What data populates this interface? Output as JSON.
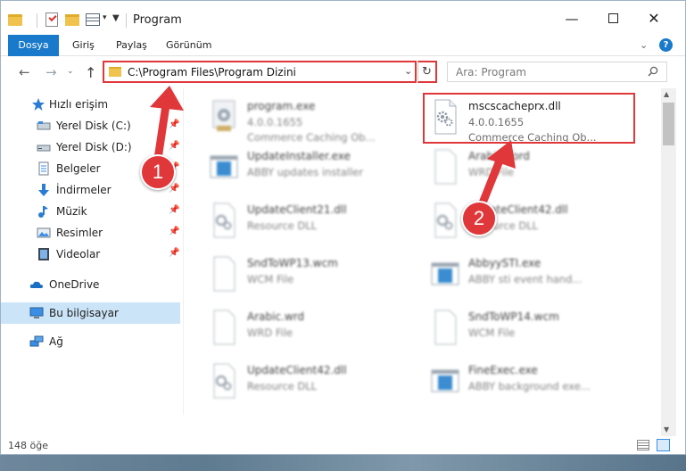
{
  "titlebar": {
    "title": "Program",
    "quick_access_icons": [
      "folder-icon",
      "properties-check-icon",
      "new-folder-icon",
      "properties-icon"
    ],
    "controls": {
      "minimize": "—",
      "maximize": "☐",
      "close": "✕"
    }
  },
  "ribbon": {
    "tabs": [
      {
        "label": "Dosya",
        "active": true
      },
      {
        "label": "Giriş",
        "active": false
      },
      {
        "label": "Paylaş",
        "active": false
      },
      {
        "label": "Görünüm",
        "active": false
      }
    ],
    "help": "?"
  },
  "navbar": {
    "address": "C:\\Program Files\\Program Dizini",
    "search_placeholder": "Ara: Program"
  },
  "sidebar": {
    "items": [
      {
        "label": "Hızlı erişim",
        "icon": "star-icon",
        "pinned": false,
        "selected": false
      },
      {
        "label": "Yerel Disk (C:)",
        "icon": "drive-icon",
        "pinned": true,
        "selected": false
      },
      {
        "label": "Yerel Disk (D:)",
        "icon": "drive-icon",
        "pinned": true,
        "selected": false
      },
      {
        "label": "Belgeler",
        "icon": "documents-icon",
        "pinned": true,
        "selected": false
      },
      {
        "label": "İndirmeler",
        "icon": "download-icon",
        "pinned": true,
        "selected": false
      },
      {
        "label": "Müzik",
        "icon": "music-icon",
        "pinned": true,
        "selected": false
      },
      {
        "label": "Resimler",
        "icon": "pictures-icon",
        "pinned": true,
        "selected": false
      },
      {
        "label": "Videolar",
        "icon": "videos-icon",
        "pinned": true,
        "selected": false
      },
      {
        "label": "OneDrive",
        "icon": "cloud-icon",
        "pinned": false,
        "selected": false
      },
      {
        "label": "Bu bilgisayar",
        "icon": "computer-icon",
        "pinned": false,
        "selected": true
      },
      {
        "label": "Ağ",
        "icon": "network-icon",
        "pinned": false,
        "selected": false
      }
    ]
  },
  "files": [
    {
      "name": "program.exe",
      "meta1": "4.0.0.1655",
      "meta2": "Commerce Caching Ob...",
      "icon": "exe-gear-icon",
      "blurred": true
    },
    {
      "name": "mscscacheprx.dll",
      "meta1": "4.0.0.1655",
      "meta2": "Commerce Caching Ob...",
      "icon": "dll-gear-icon",
      "blurred": false
    },
    {
      "name": "UpdateInstaller.exe",
      "meta1": "ABBY updates installer",
      "meta2": "",
      "icon": "exe-window-icon",
      "blurred": true
    },
    {
      "name": "ArabicWord",
      "meta1": "WRD File",
      "meta2": "",
      "icon": "blank-file-icon",
      "blurred": true
    },
    {
      "name": "UpdateClient21.dll",
      "meta1": "Resource DLL",
      "meta2": "",
      "icon": "dll-gear-icon",
      "blurred": true
    },
    {
      "name": "UpdateClient42.dll",
      "meta1": "Resource DLL",
      "meta2": "",
      "icon": "dll-gear-icon",
      "blurred": true
    },
    {
      "name": "SndToWP13.wcm",
      "meta1": "WCM File",
      "meta2": "",
      "icon": "blank-file-icon",
      "blurred": true
    },
    {
      "name": "AbbyySTI.exe",
      "meta1": "ABBY sti event hand...",
      "meta2": "",
      "icon": "exe-window-icon",
      "blurred": true
    },
    {
      "name": "Arabic.wrd",
      "meta1": "WRD File",
      "meta2": "",
      "icon": "blank-file-icon",
      "blurred": true
    },
    {
      "name": "SndToWP14.wcm",
      "meta1": "WCM File",
      "meta2": "",
      "icon": "blank-file-icon",
      "blurred": true
    },
    {
      "name": "UpdateClient42.dll",
      "meta1": "Resource DLL",
      "meta2": "",
      "icon": "dll-gear-icon",
      "blurred": true
    },
    {
      "name": "FineExec.exe",
      "meta1": "ABBY background exe...",
      "meta2": "",
      "icon": "exe-window-icon",
      "blurred": true
    }
  ],
  "status": {
    "item_count": "148 öğe"
  },
  "annotations": {
    "step1": "1",
    "step2": "2",
    "color": "#e0373a"
  }
}
